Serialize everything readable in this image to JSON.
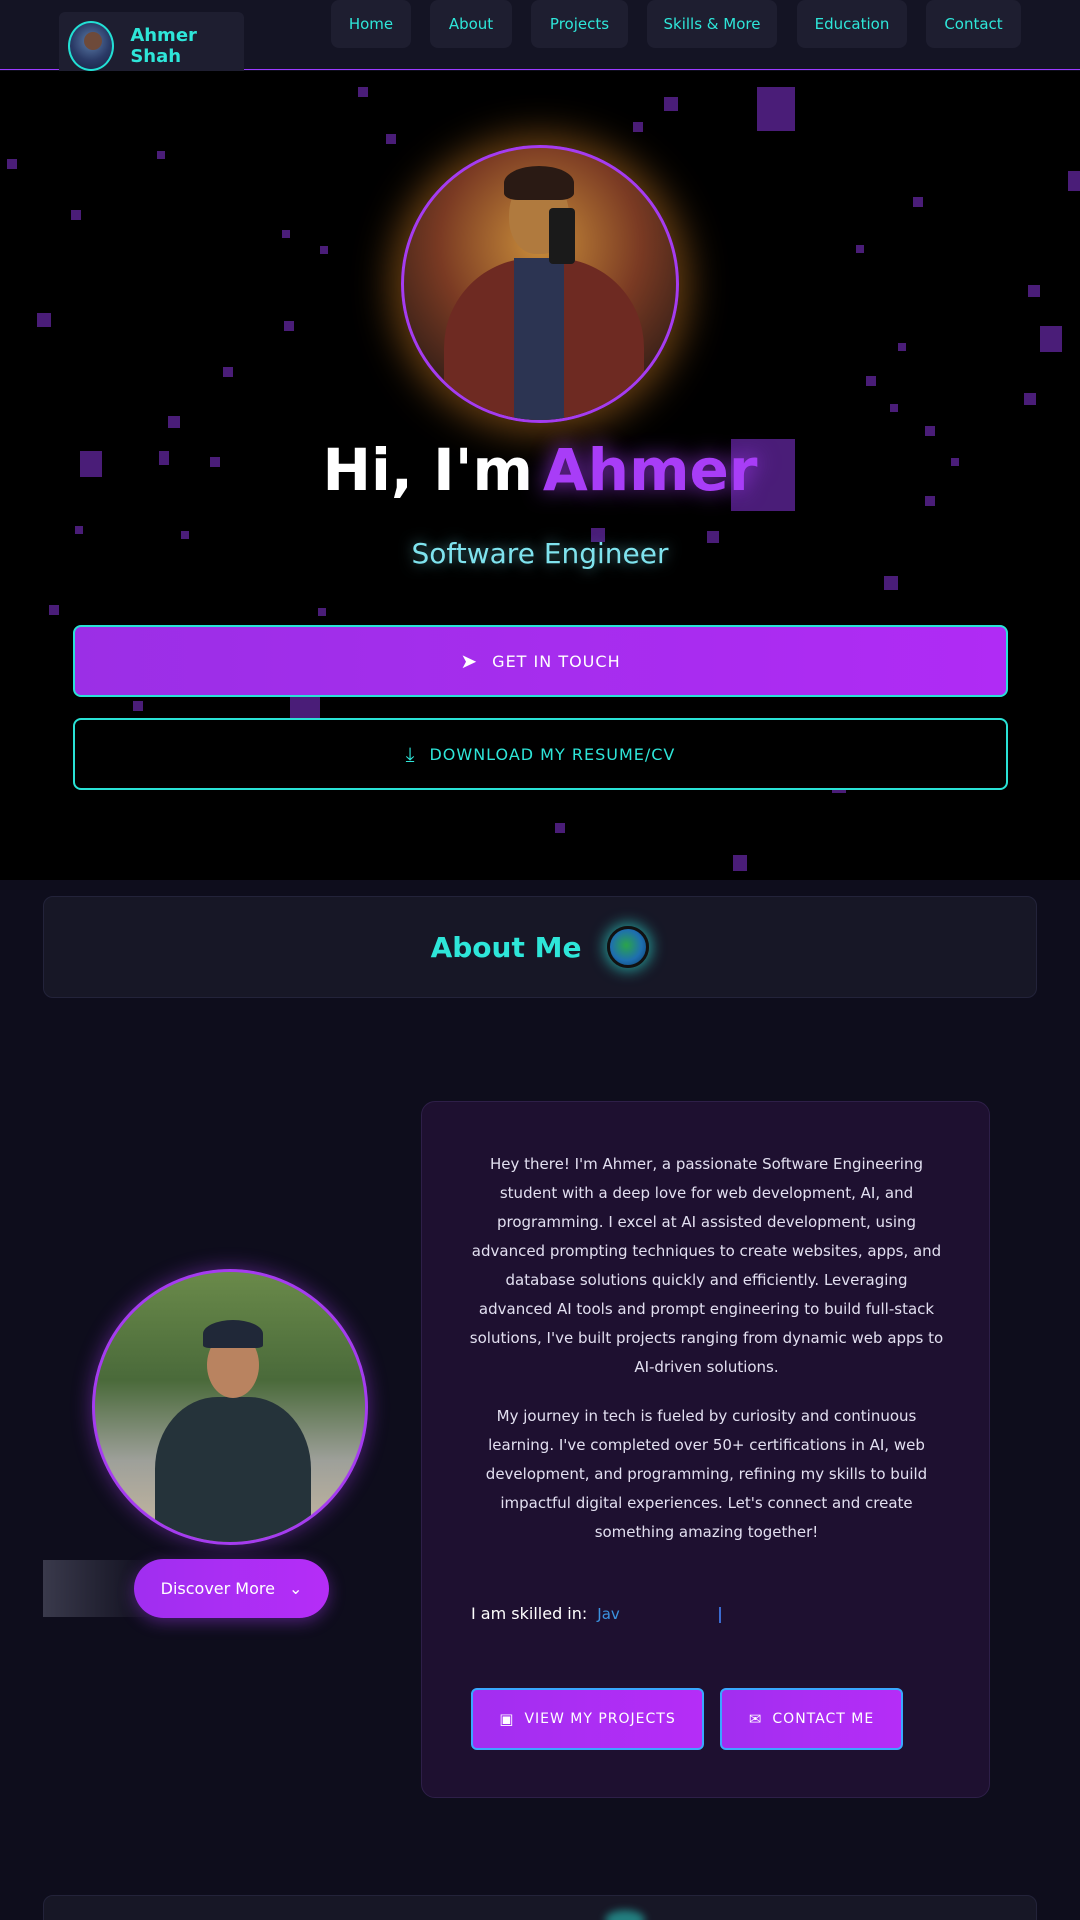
{
  "nav": {
    "brand_name": "Ahmer Shah",
    "links": [
      "Home",
      "About",
      "Projects",
      "Skills & More",
      "Education",
      "Contact"
    ]
  },
  "hero": {
    "greeting": "Hi, I'm",
    "name": "Ahmer",
    "role": "Software Engineer",
    "cta_primary": "GET IN TOUCH",
    "cta_primary_icon": "paper-plane-icon",
    "cta_secondary": "DOWNLOAD MY RESUME/CV",
    "cta_secondary_icon": "download-icon"
  },
  "about": {
    "title": "About Me",
    "title_icon": "globe-icon",
    "discover_label": "Discover More",
    "paragraph1": "Hey there! I'm Ahmer, a passionate Software Engineering student with a deep love for web development, AI, and programming. I excel at AI assisted development, using advanced prompting techniques to create websites, apps, and database solutions quickly and efficiently. Leveraging advanced AI tools and prompt engineering to build full-stack solutions, I've built projects ranging from dynamic web apps to AI-driven solutions.",
    "paragraph2": "My journey in tech is fueled by curiosity and continuous learning. I've completed over 50+ certifications in AI, web development, and programming, refining my skills to build impactful digital experiences. Let's connect and create something amazing together!",
    "skilled_label": "I am skilled in:",
    "skilled_typed": "Jav",
    "btn_projects": "VIEW MY PROJECTS",
    "btn_contact": "CONTACT ME"
  },
  "colors": {
    "accent_purple": "#a83df7",
    "accent_cyan": "#2ee6d9",
    "background": "#0e0d1c"
  }
}
